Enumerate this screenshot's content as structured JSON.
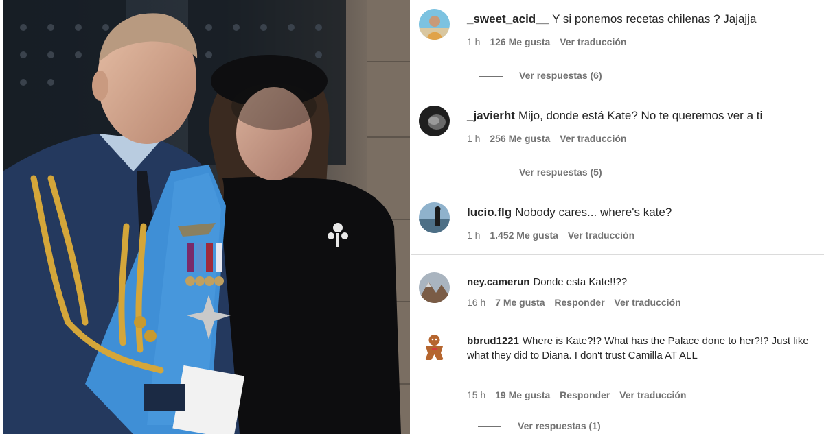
{
  "comments": [
    {
      "username": "_sweet_acid__",
      "text": "Y si ponemos recetas chilenas ? Jajajja",
      "time": "1 h",
      "likes": "126 Me gusta",
      "translate": "Ver traducción",
      "replies": "Ver respuestas (6)",
      "avatar": "beach-person-avatar"
    },
    {
      "username": "_javierht",
      "text": "Mijo, donde está Kate? No te queremos ver a ti",
      "time": "1 h",
      "likes": "256 Me gusta",
      "translate": "Ver traducción",
      "replies": "Ver respuestas (5)",
      "avatar": "dark-portrait-avatar"
    },
    {
      "username": "lucio.flg",
      "text": "Nobody cares... where's kate?",
      "time": "1 h",
      "likes": "1.452 Me gusta",
      "translate": "Ver traducción",
      "avatar": "lake-silhouette-avatar"
    },
    {
      "username": "ney.camerun",
      "text": "Donde esta Kate!!??",
      "time": "16 h",
      "likes": "7 Me gusta",
      "reply": "Responder",
      "translate": "Ver traducción",
      "avatar": "mountain-avatar"
    },
    {
      "username": "bbrud1221",
      "text": "Where is Kate?!? What has the Palace done to her?!? Just like what they did to Diana. I don't trust Camilla AT ALL",
      "time": "15 h",
      "likes": "19 Me gusta",
      "reply": "Responder",
      "translate": "Ver traducción",
      "replies": "Ver respuestas (1)",
      "avatar": "gingerbread-avatar"
    }
  ],
  "colors": {
    "text_primary": "#262626",
    "text_secondary": "#737373",
    "separator": "#dbdbdb",
    "uniform_blue": "#2c4a7c",
    "sash_blue": "#3f8fd6",
    "gold_aiguillette": "#d4a63a"
  }
}
